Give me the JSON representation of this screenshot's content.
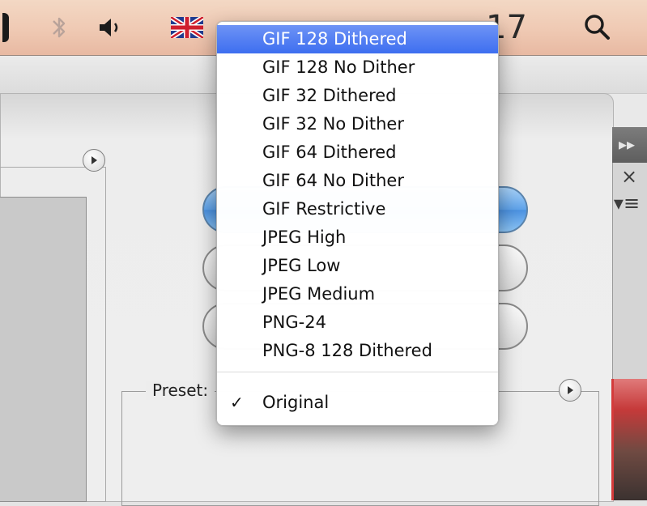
{
  "menubar": {
    "time_text": "17",
    "icons": [
      "bluetooth-icon",
      "volume-icon",
      "uk-flag-icon",
      "spotlight-search-icon"
    ]
  },
  "panel": {
    "preset_label": "Preset:"
  },
  "popup_menu": {
    "items": [
      {
        "label": "GIF 128 Dithered",
        "selected": true
      },
      {
        "label": "GIF 128 No Dither",
        "selected": false
      },
      {
        "label": "GIF 32 Dithered",
        "selected": false
      },
      {
        "label": "GIF 32 No Dither",
        "selected": false
      },
      {
        "label": "GIF 64 Dithered",
        "selected": false
      },
      {
        "label": "GIF 64 No Dither",
        "selected": false
      },
      {
        "label": "GIF Restrictive",
        "selected": false
      },
      {
        "label": "JPEG High",
        "selected": false
      },
      {
        "label": "JPEG Low",
        "selected": false
      },
      {
        "label": "JPEG Medium",
        "selected": false
      },
      {
        "label": "PNG-24",
        "selected": false
      },
      {
        "label": "PNG-8 128 Dithered",
        "selected": false
      }
    ],
    "checked_item": {
      "label": "Original",
      "check": "✓"
    }
  },
  "colors": {
    "selection_blue": "#3d6ef0",
    "menubar_peach": "#efc9b3"
  }
}
